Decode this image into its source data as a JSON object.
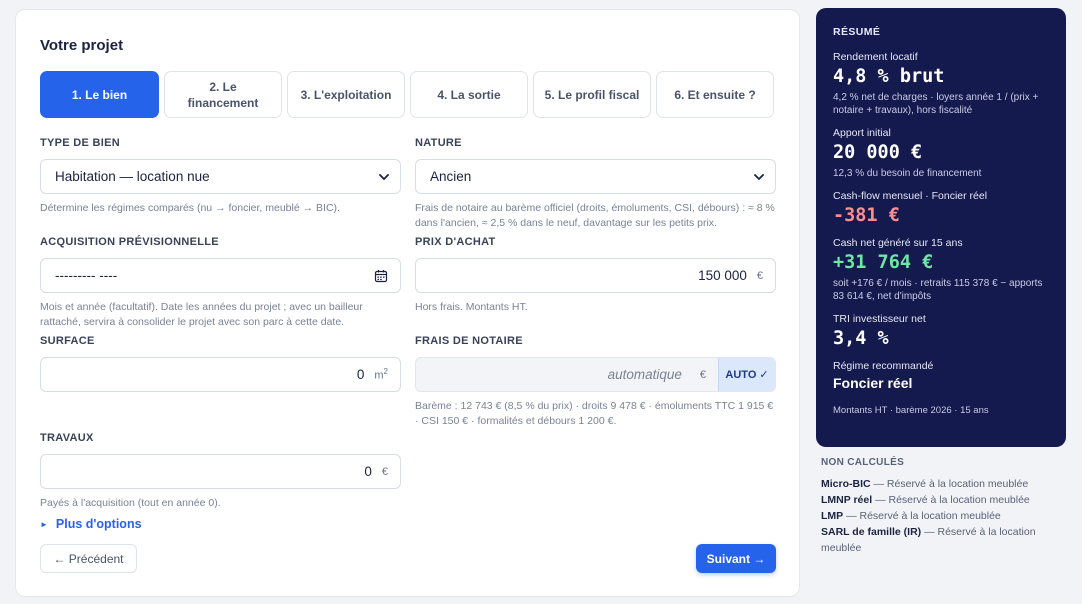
{
  "page": {
    "title": "Votre projet"
  },
  "tabs": [
    {
      "label": "1. Le bien",
      "active": true
    },
    {
      "label": "2. Le financement",
      "active": false
    },
    {
      "label": "3. L'exploitation",
      "active": false
    },
    {
      "label": "4. La sortie",
      "active": false
    },
    {
      "label": "5. Le profil fiscal",
      "active": false
    },
    {
      "label": "6. Et ensuite ?",
      "active": false
    }
  ],
  "form": {
    "type_bien": {
      "label": "TYPE DE BIEN",
      "value": "Habitation — location nue",
      "hint": "Détermine les régimes comparés (nu → foncier, meublé → BIC)."
    },
    "nature": {
      "label": "NATURE",
      "value": "Ancien",
      "hint": "Frais de notaire au barème officiel (droits, émoluments, CSI, débours) : ≈ 8 % dans l'ancien, ≈ 2,5 % dans le neuf, davantage sur les petits prix."
    },
    "acquisition": {
      "label": "ACQUISITION PRÉVISIONNELLE",
      "value": "--------- ----",
      "hint": "Mois et année (facultatif). Date les années du projet ; avec un bailleur rattaché, servira à consolider le projet avec son parc à cette date."
    },
    "prix": {
      "label": "PRIX D'ACHAT",
      "value": "150 000",
      "unit": "€",
      "hint": "Hors frais. Montants HT."
    },
    "surface": {
      "label": "SURFACE",
      "value": "0",
      "unit": "m",
      "unit_sup": "2"
    },
    "frais_notaire": {
      "label": "FRAIS DE NOTAIRE",
      "placeholder": "automatique",
      "unit": "€",
      "auto_label": "AUTO",
      "auto_check": "✓",
      "hint": "Barème : 12 743 € (8,5 % du prix) · droits 9 478 € · émoluments TTC 1 915 € · CSI 150 € · formalités et débours 1 200 €."
    },
    "travaux": {
      "label": "TRAVAUX",
      "value": "0",
      "unit": "€",
      "hint": "Payés à l'acquisition (tout en année 0)."
    }
  },
  "more_options": {
    "label": "Plus d'options",
    "marker": "►"
  },
  "nav": {
    "prev_label": "← Précédent",
    "next_label": "Suivant →"
  },
  "summary": {
    "title": "RÉSUMÉ",
    "rendement": {
      "label": "Rendement locatif",
      "value": "4,8 % brut",
      "sub": "4,2 % net de charges · loyers année 1 / (prix + notaire + travaux), hors fiscalité"
    },
    "apport": {
      "label": "Apport initial",
      "value": "20 000 €",
      "sub": "12,3 % du besoin de financement"
    },
    "cashflow": {
      "label": "Cash-flow mensuel · Foncier réel",
      "value": "-381 €"
    },
    "cash_net": {
      "label": "Cash net généré sur 15 ans",
      "value": "+31 764 €",
      "sub": "soit +176 € / mois · retraits 115 378 € − apports 83 614 €, net d'impôts"
    },
    "tri": {
      "label": "TRI investisseur net",
      "value": "3,4 %"
    },
    "regime": {
      "label": "Régime recommandé",
      "value": "Foncier réel"
    },
    "footer": "Montants HT · barème 2026 · 15 ans"
  },
  "non_calcules": {
    "title": "NON CALCULÉS",
    "items": [
      {
        "name": "Micro-BIC",
        "reason": " — Réservé à la location meublée"
      },
      {
        "name": "LMNP réel",
        "reason": " — Réservé à la location meublée"
      },
      {
        "name": "LMP",
        "reason": " — Réservé à la location meublée"
      },
      {
        "name": "SARL de famille (IR)",
        "reason": " — Réservé à la location meublée"
      }
    ]
  },
  "colors": {
    "primary": "#2563eb",
    "summary_bg": "#151a4e",
    "negative": "#ff8e8e",
    "positive": "#6ee7a6"
  }
}
